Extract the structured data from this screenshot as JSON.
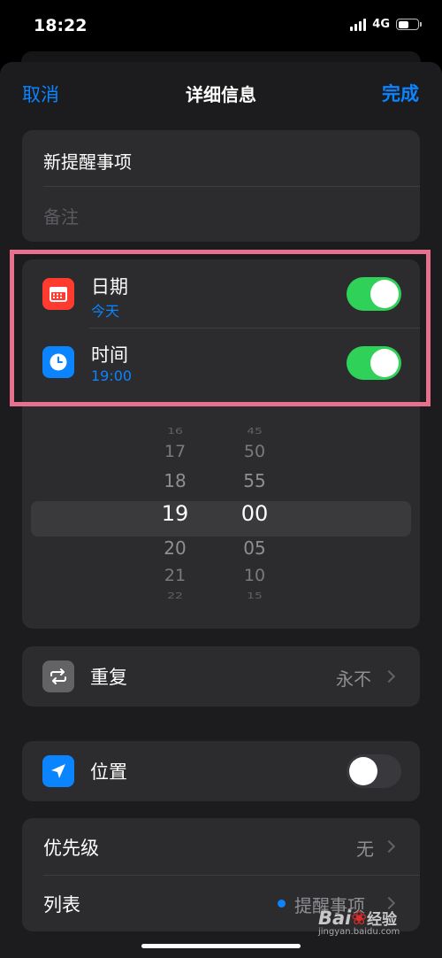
{
  "status_bar": {
    "time": "18:22",
    "network": "4G",
    "battery_level": 0.55
  },
  "nav": {
    "cancel": "取消",
    "title": "详细信息",
    "done": "完成"
  },
  "title_card": {
    "title_value": "新提醒事项",
    "notes_placeholder": "备注"
  },
  "date_row": {
    "label": "日期",
    "sub": "今天",
    "icon": "calendar-icon",
    "icon_color": "#ff3b30",
    "toggle_on": true
  },
  "time_row": {
    "label": "时间",
    "sub": "19:00",
    "icon": "clock-icon",
    "icon_color": "#0a84ff",
    "toggle_on": true
  },
  "picker": {
    "hours": [
      "16",
      "17",
      "18",
      "19",
      "20",
      "21",
      "22"
    ],
    "minutes": [
      "45",
      "50",
      "55",
      "00",
      "05",
      "10",
      "15"
    ],
    "selected_hour": "19",
    "selected_minute": "00"
  },
  "repeat_row": {
    "label": "重复",
    "value": "永不",
    "icon": "repeat-icon",
    "icon_color": "#636366"
  },
  "location_row": {
    "label": "位置",
    "icon": "location-arrow-icon",
    "icon_color": "#0a84ff",
    "toggle_on": false
  },
  "priority_row": {
    "label": "优先级",
    "value": "无"
  },
  "list_row": {
    "label": "列表",
    "value": "提醒事项",
    "dot_color": "#0a84ff"
  },
  "watermark": {
    "logo_prefix": "Bai",
    "logo_suffix": "经验",
    "url": "jingyan.baidu.com"
  },
  "colors": {
    "accent": "#0a84ff",
    "toggle_on": "#30d158",
    "highlight": "#e8708f"
  }
}
